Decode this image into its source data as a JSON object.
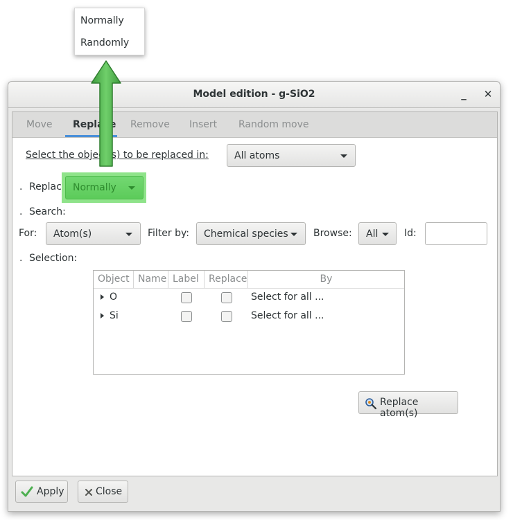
{
  "popup": {
    "items": [
      "Normally",
      "Randomly"
    ]
  },
  "window": {
    "title": "Model edition - g-SiO2",
    "minimize": "_",
    "close": "✕"
  },
  "tabs": [
    {
      "label": "Move",
      "active": false
    },
    {
      "label": "Replace",
      "active": true
    },
    {
      "label": "Remove",
      "active": false
    },
    {
      "label": "Insert",
      "active": false
    },
    {
      "label": "Random move",
      "active": false
    }
  ],
  "replace_panel": {
    "select_objects_label": "Select the object(s) to be replaced in:",
    "select_objects_value": "All atoms",
    "bullet": ".",
    "replace_label": "Replace:",
    "replace_value": "Normally",
    "search_label": "Search:",
    "for_label": "For:",
    "for_value": "Atom(s)",
    "filter_label": "Filter by:",
    "filter_value": "Chemical species",
    "browse_label": "Browse:",
    "browse_value": "All",
    "id_label": "Id:",
    "id_value": "",
    "selection_label": "Selection:",
    "table": {
      "columns": [
        "Object",
        "Name",
        "Label",
        "Replace",
        "By"
      ],
      "rows": [
        {
          "object": "O",
          "name": "",
          "label": false,
          "replace": false,
          "by": "Select for all ..."
        },
        {
          "object": "Si",
          "name": "",
          "label": false,
          "replace": false,
          "by": "Select for all ..."
        }
      ]
    },
    "replace_button": "Replace atom(s)"
  },
  "footer": {
    "apply": "Apply",
    "close": "Close"
  },
  "colors": {
    "highlight": "#8fe38a",
    "arrow": "#4caf50",
    "tab_accent": "#4a90d9"
  },
  "icons": {
    "apply": "check-icon",
    "close": "x-icon",
    "replace": "atom-magnify-icon"
  }
}
